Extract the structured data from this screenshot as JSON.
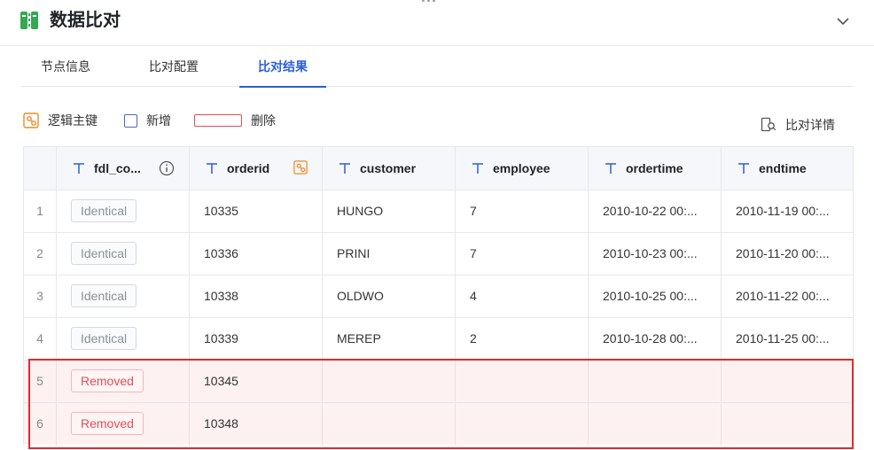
{
  "header": {
    "title": "数据比对",
    "icon": "compare-icon",
    "collapse_icon": "chevron-down-icon"
  },
  "tabs": [
    {
      "label": "节点信息",
      "active": false
    },
    {
      "label": "比对配置",
      "active": false
    },
    {
      "label": "比对结果",
      "active": true
    }
  ],
  "legend": {
    "primary_key": "逻辑主键",
    "added": "新增",
    "deleted": "删除"
  },
  "detail_button": "比对详情",
  "columns": [
    "fdl_co...",
    "orderid",
    "customer",
    "employee",
    "ordertime",
    "endtime"
  ],
  "rows": [
    {
      "index": "1",
      "status": "Identical",
      "orderid": "10335",
      "customer": "HUNGO",
      "employee": "7",
      "ordertime": "2010-10-22 00:...",
      "endtime": "2010-11-19 00:..."
    },
    {
      "index": "2",
      "status": "Identical",
      "orderid": "10336",
      "customer": "PRINI",
      "employee": "7",
      "ordertime": "2010-10-23 00:...",
      "endtime": "2010-11-20 00:..."
    },
    {
      "index": "3",
      "status": "Identical",
      "orderid": "10338",
      "customer": "OLDWO",
      "employee": "4",
      "ordertime": "2010-10-25 00:...",
      "endtime": "2010-11-22 00:..."
    },
    {
      "index": "4",
      "status": "Identical",
      "orderid": "10339",
      "customer": "MEREP",
      "employee": "2",
      "ordertime": "2010-10-28 00:...",
      "endtime": "2010-11-25 00:..."
    },
    {
      "index": "5",
      "status": "Removed",
      "orderid": "10345",
      "customer": "",
      "employee": "",
      "ordertime": "",
      "endtime": ""
    },
    {
      "index": "6",
      "status": "Removed",
      "orderid": "10348",
      "customer": "",
      "employee": "",
      "ordertime": "",
      "endtime": ""
    }
  ],
  "colors": {
    "accent": "#2b5fd9",
    "removed": "#e34d59",
    "added": "#5b5fc7",
    "pk": "#f08a24",
    "highlight": "#e02b2b"
  }
}
